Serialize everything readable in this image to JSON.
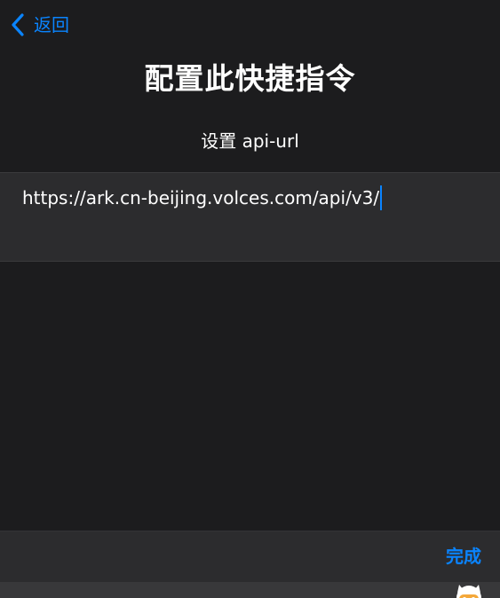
{
  "nav": {
    "back_label": "返回",
    "back_icon": "chevron-left-icon"
  },
  "header": {
    "title": "配置此快捷指令"
  },
  "field": {
    "label": "设置 api-url",
    "value": "https://ark.cn-beijing.volces.com/api/v3/"
  },
  "toolbar": {
    "done_label": "完成"
  },
  "colors": {
    "background": "#1c1c1e",
    "panel": "#2c2c2e",
    "accent": "#0a84ff",
    "text": "#ffffff",
    "bottom_strip": "#38383a"
  },
  "icons": {
    "avatar": "robot-avatar-icon"
  }
}
